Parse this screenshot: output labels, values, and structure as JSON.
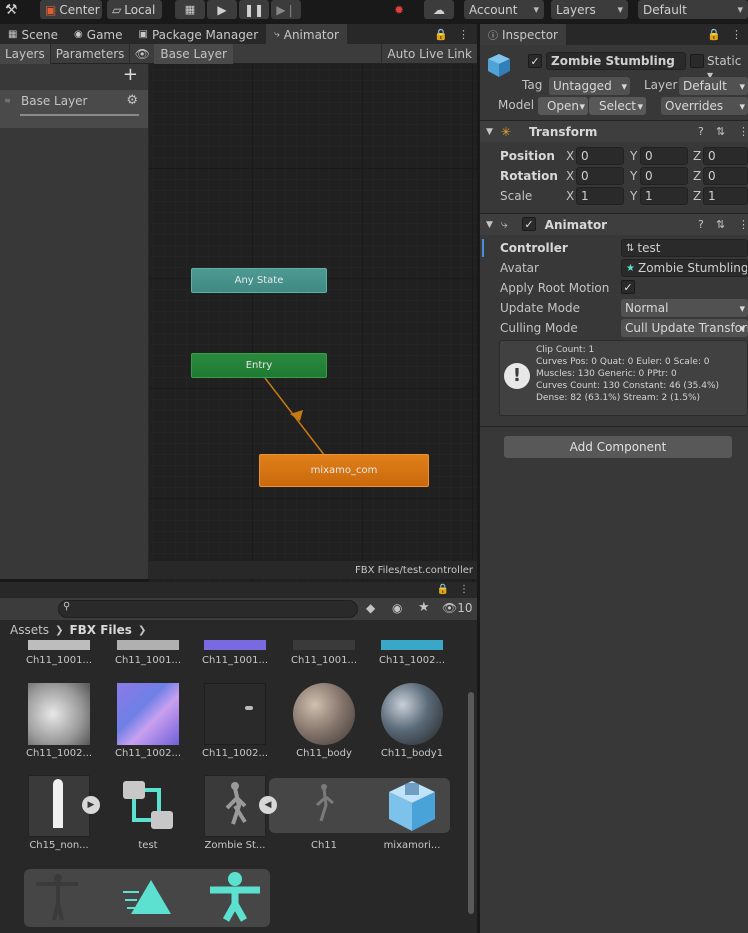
{
  "toolbar": {
    "pivot_label": "Center",
    "space_label": "Local",
    "account_label": "Account",
    "layers_label": "Layers",
    "layout_label": "Default"
  },
  "tabs": {
    "scene": "Scene",
    "game": "Game",
    "package_manager": "Package Manager",
    "animator": "Animator",
    "inspector": "Inspector"
  },
  "animator": {
    "sub_tabs": [
      "Layers",
      "Parameters"
    ],
    "breadcrumb": "Base Layer",
    "auto_live_link": "Auto Live Link",
    "layer_name": "Base Layer",
    "footer_path": "FBX Files/test.controller",
    "nodes": {
      "any_state": "Any State",
      "entry": "Entry",
      "default_state": "mixamo_com"
    },
    "colors": {
      "any_state": "#3f8a83",
      "entry": "#1f7a32",
      "default_state": "#d6730d",
      "transition": "#c67a12"
    }
  },
  "inspector": {
    "object_name": "Zombie Stumbling",
    "static_label": "Static",
    "tag_label": "Tag",
    "tag_value": "Untagged",
    "layer_label": "Layer",
    "layer_value": "Default",
    "model_label": "Model",
    "open_button": "Open",
    "select_button": "Select",
    "overrides_button": "Overrides",
    "transform": {
      "title": "Transform",
      "position_label": "Position",
      "rotation_label": "Rotation",
      "scale_label": "Scale",
      "position": {
        "x": "0",
        "y": "0",
        "z": "0"
      },
      "rotation": {
        "x": "0",
        "y": "0",
        "z": "0"
      },
      "scale": {
        "x": "1",
        "y": "1",
        "z": "1"
      }
    },
    "animator": {
      "title": "Animator",
      "controller_label": "Controller",
      "controller_value": "test",
      "avatar_label": "Avatar",
      "avatar_value": "Zombie Stumbling",
      "apply_root_label": "Apply Root Motion",
      "update_mode_label": "Update Mode",
      "update_mode_value": "Normal",
      "culling_label": "Culling Mode",
      "culling_value": "Cull Update Transforms",
      "info": [
        "Clip Count: 1",
        "Curves Pos: 0 Quat: 0 Euler: 0 Scale: 0",
        "Muscles: 130 Generic: 0 PPtr: 0",
        "Curves Count: 130 Constant: 46 (35.4%)",
        "Dense: 82 (63.1%) Stream: 2 (1.5%)"
      ]
    },
    "add_component": "Add Component"
  },
  "project": {
    "breadcrumb": [
      "Assets",
      "FBX Files"
    ],
    "hidden_count": "10",
    "assets": [
      {
        "label": "Ch11_1001..."
      },
      {
        "label": "Ch11_1001..."
      },
      {
        "label": "Ch11_1001..."
      },
      {
        "label": "Ch11_1001..."
      },
      {
        "label": "Ch11_1002..."
      },
      {
        "label": "Ch11_1002..."
      },
      {
        "label": "Ch11_1002..."
      },
      {
        "label": "Ch11_1002..."
      },
      {
        "label": "Ch11_body"
      },
      {
        "label": "Ch11_body1"
      },
      {
        "label": "Ch15_non..."
      },
      {
        "label": "test"
      },
      {
        "label": "Zombie St..."
      },
      {
        "label": "Ch11"
      },
      {
        "label": "mixamori..."
      }
    ]
  }
}
